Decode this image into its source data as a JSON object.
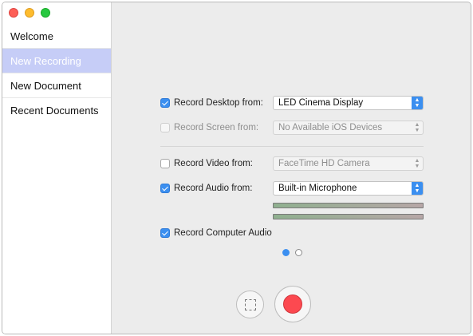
{
  "sidebar": {
    "items": [
      {
        "label": "Welcome"
      },
      {
        "label": "New Recording"
      },
      {
        "label": "New Document"
      },
      {
        "label": "Recent Documents"
      }
    ]
  },
  "recording": {
    "desktop": {
      "label": "Record Desktop from:",
      "checked": true,
      "value": "LED Cinema Display"
    },
    "screen": {
      "label": "Record Screen from:",
      "checked": false,
      "value": "No Available iOS Devices"
    },
    "video": {
      "label": "Record Video from:",
      "checked": false,
      "value": "FaceTime HD Camera"
    },
    "audio": {
      "label": "Record Audio from:",
      "checked": true,
      "value": "Built-in Microphone"
    },
    "computer_audio": {
      "label": "Record Computer Audio",
      "checked": true
    }
  },
  "pager": {
    "current": 1,
    "total": 2
  },
  "icons": {
    "region": "dashed-square-icon",
    "record": "record-dot-icon",
    "stepper": "up-down-chevron-icon"
  },
  "colors": {
    "accent": "#3b8ff0",
    "record": "#fc4950",
    "selected_item": "#c6cdf7"
  }
}
